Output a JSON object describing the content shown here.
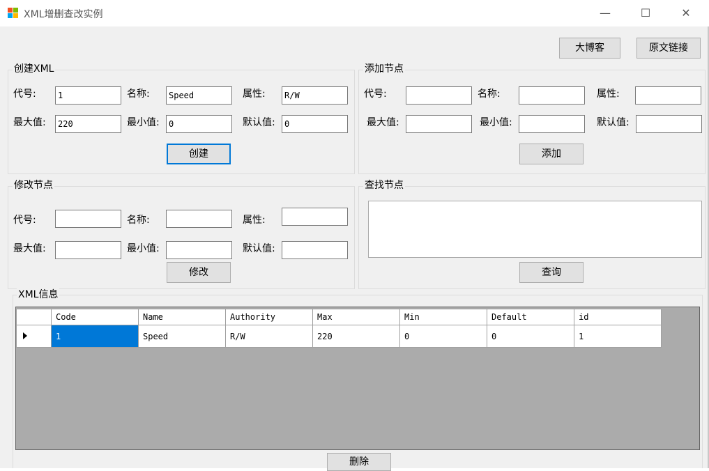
{
  "window": {
    "title": "XML增删查改实例",
    "minimize": "—",
    "maximize": "☐",
    "close": "✕"
  },
  "top_buttons": {
    "blog": "大博客",
    "source_link": "原文链接"
  },
  "create_group": {
    "legend": "创建XML",
    "code_label": "代号:",
    "code_value": "1",
    "name_label": "名称:",
    "name_value": "Speed",
    "attr_label": "属性:",
    "attr_value": "R/W",
    "max_label": "最大值:",
    "max_value": "220",
    "min_label": "最小值:",
    "min_value": "0",
    "default_label": "默认值:",
    "default_value": "0",
    "button": "创建"
  },
  "add_group": {
    "legend": "添加节点",
    "code_label": "代号:",
    "name_label": "名称:",
    "attr_label": "属性:",
    "max_label": "最大值:",
    "min_label": "最小值:",
    "default_label": "默认值:",
    "button": "添加"
  },
  "modify_group": {
    "legend": "修改节点",
    "code_label": "代号:",
    "name_label": "名称:",
    "attr_label": "属性:",
    "max_label": "最大值:",
    "min_label": "最小值:",
    "default_label": "默认值:",
    "button": "修改"
  },
  "query_group": {
    "legend": "查找节点",
    "button": "查询"
  },
  "xml_info": {
    "legend": "XML信息",
    "columns": [
      "Code",
      "Name",
      "Authority",
      "Max",
      "Min",
      "Default",
      "id"
    ],
    "rows": [
      [
        "1",
        "Speed",
        "R/W",
        "220",
        "0",
        "0",
        "1"
      ]
    ],
    "delete_button": "删除"
  },
  "colors": {
    "selection": "#0078d7",
    "window_bg": "#f0f0f0",
    "grid_bg": "#ababab"
  }
}
